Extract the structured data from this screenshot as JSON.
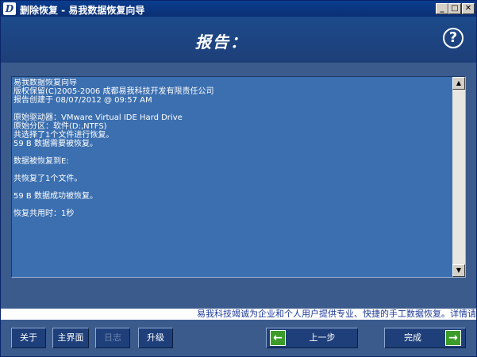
{
  "window": {
    "title": "删除恢复 - 易我数据恢复向导",
    "icon_letter": "D",
    "minimize_label": "_",
    "maximize_label": "□",
    "close_label": "✕"
  },
  "header": {
    "title": "报告：",
    "help_label": "?"
  },
  "report": {
    "text": "易我数据恢复向导\n版权保留(C)2005-2006 成都易我科技开发有限责任公司\n报告创建于 08/07/2012 @ 09:57 AM\n\n原始驱动器：VMware Virtual IDE Hard Drive\n原始分区：软件(D:,NTFS)\n共选择了1个文件进行恢复。\n59 B 数据需要被恢复。\n\n数据被恢复到E:\n\n共恢复了1个文件。\n\n59 B 数据成功被恢复。\n\n恢复共用时：1秒",
    "scroll_up": "▲",
    "scroll_down": "▼"
  },
  "slogan": "易我科技竭诚为企业和个人用户提供专业、快捷的手工数据恢复。详情请",
  "buttons": {
    "about": "关于",
    "main": "主界面",
    "log": "日志",
    "upgrade": "升级",
    "back": "上一步",
    "finish": "完成",
    "back_arrow": "←",
    "finish_arrow": "→"
  },
  "colors": {
    "background": "#3a5b8c",
    "header": "#1e3f79",
    "report_bg": "#3b6fb0",
    "arrow_green": "#3c9c2a",
    "slogan_text": "#1c3a9a"
  }
}
